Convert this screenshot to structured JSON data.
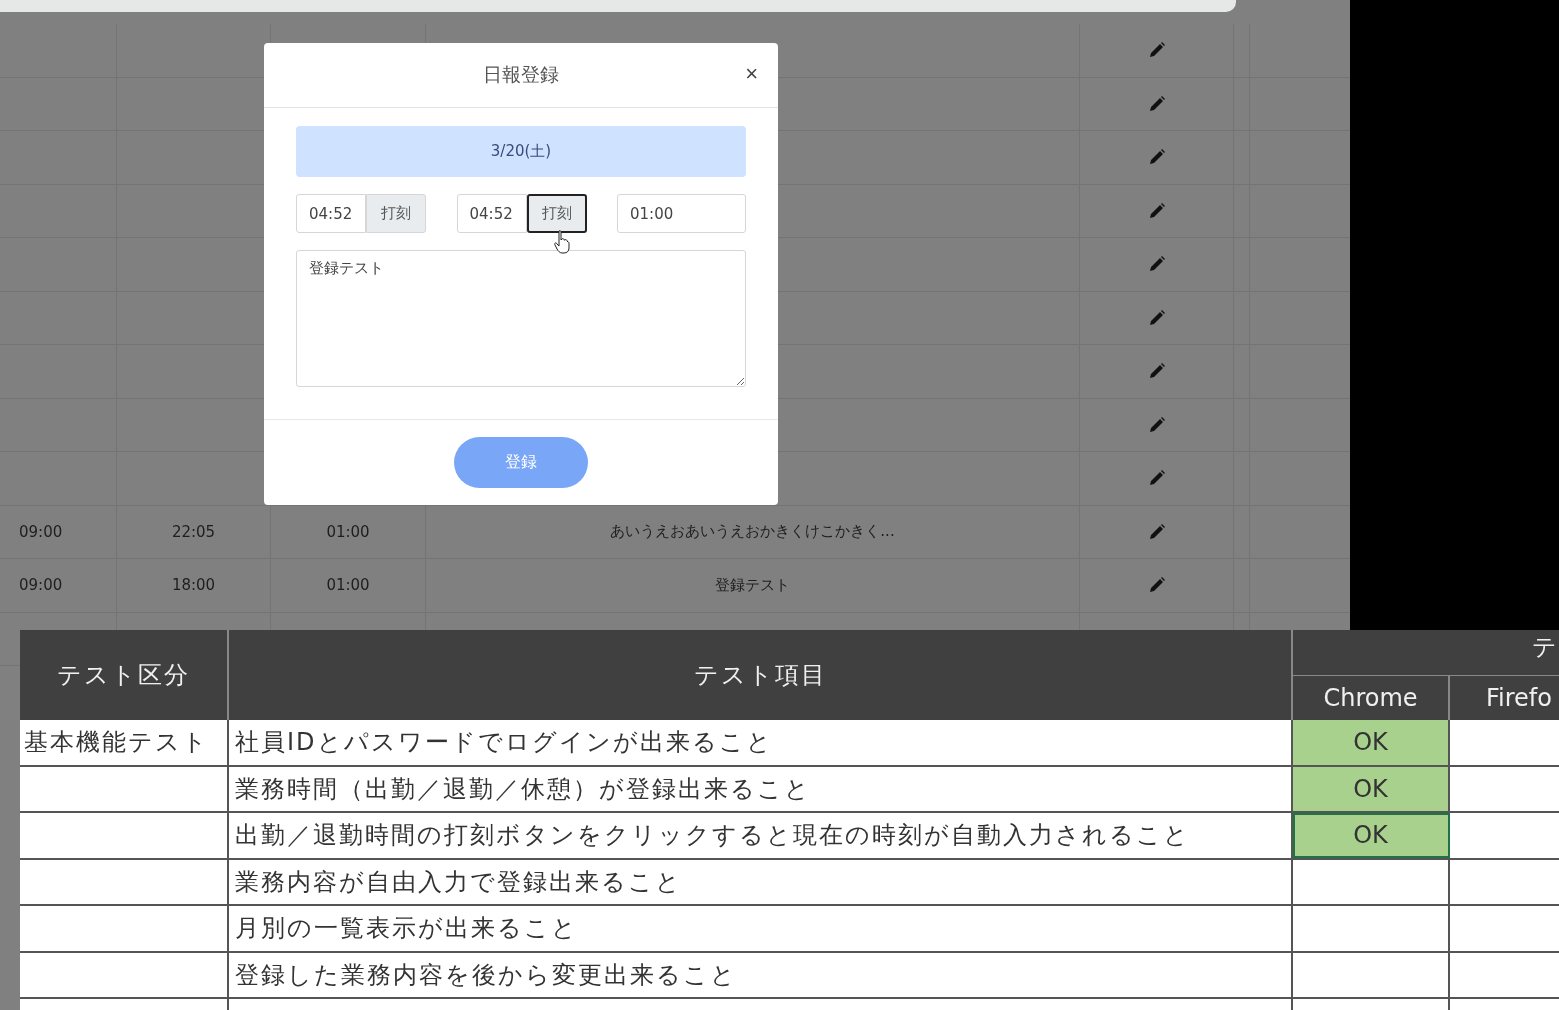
{
  "page_table": {
    "rows": [
      {
        "kind": "blank"
      },
      {
        "kind": "blank"
      },
      {
        "kind": "blank"
      },
      {
        "kind": "blank"
      },
      {
        "kind": "blank"
      },
      {
        "kind": "blank"
      },
      {
        "kind": "blank"
      },
      {
        "kind": "blank"
      },
      {
        "kind": "blank"
      },
      {
        "kind": "entry",
        "column_1": "09:00",
        "column_2": "22:05",
        "column_3": "01:00",
        "column_4": "あいうえおあいうえおかきくけこかきく..."
      },
      {
        "kind": "entry",
        "column_1": "09:00",
        "column_2": "18:00",
        "column_3": "01:00",
        "column_4": "登録テスト"
      },
      {
        "kind": "blank"
      }
    ]
  },
  "modal": {
    "title": "日報登録",
    "close": "×",
    "date": "3/20(土)",
    "time_fields": [
      {
        "kind": "stamp",
        "value": "04:52",
        "button": "打刻",
        "focused": false
      },
      {
        "kind": "stamp",
        "value": "04:52",
        "button": "打刻",
        "focused": true
      },
      {
        "kind": "plain",
        "value": "01:00"
      }
    ],
    "content": "登録テスト",
    "submit": "登録"
  },
  "spreadsheet": {
    "header": {
      "column_1": "テスト区分",
      "column_2": "テスト項目",
      "group": "テ",
      "browsers": [
        "Chrome",
        "Firefo"
      ]
    },
    "rows": [
      {
        "category": "基本機能テスト",
        "item": "社員IDとパスワードでログインが出来ること",
        "chrome": "OK",
        "chrome_selected": false
      },
      {
        "item": "業務時間（出勤／退勤／休憩）が登録出来ること",
        "chrome": "OK",
        "chrome_selected": false
      },
      {
        "item": "出勤／退勤時間の打刻ボタンをクリックすると現在の時刻が自動入力されること",
        "chrome": "OK",
        "chrome_selected": true
      },
      {
        "item": "業務内容が自由入力で登録出来ること",
        "chrome_selected": false
      },
      {
        "item": "月別の一覧表示が出来ること",
        "chrome_selected": false
      },
      {
        "item": "登録した業務内容を後から変更出来ること",
        "chrome_selected": false
      }
    ]
  }
}
